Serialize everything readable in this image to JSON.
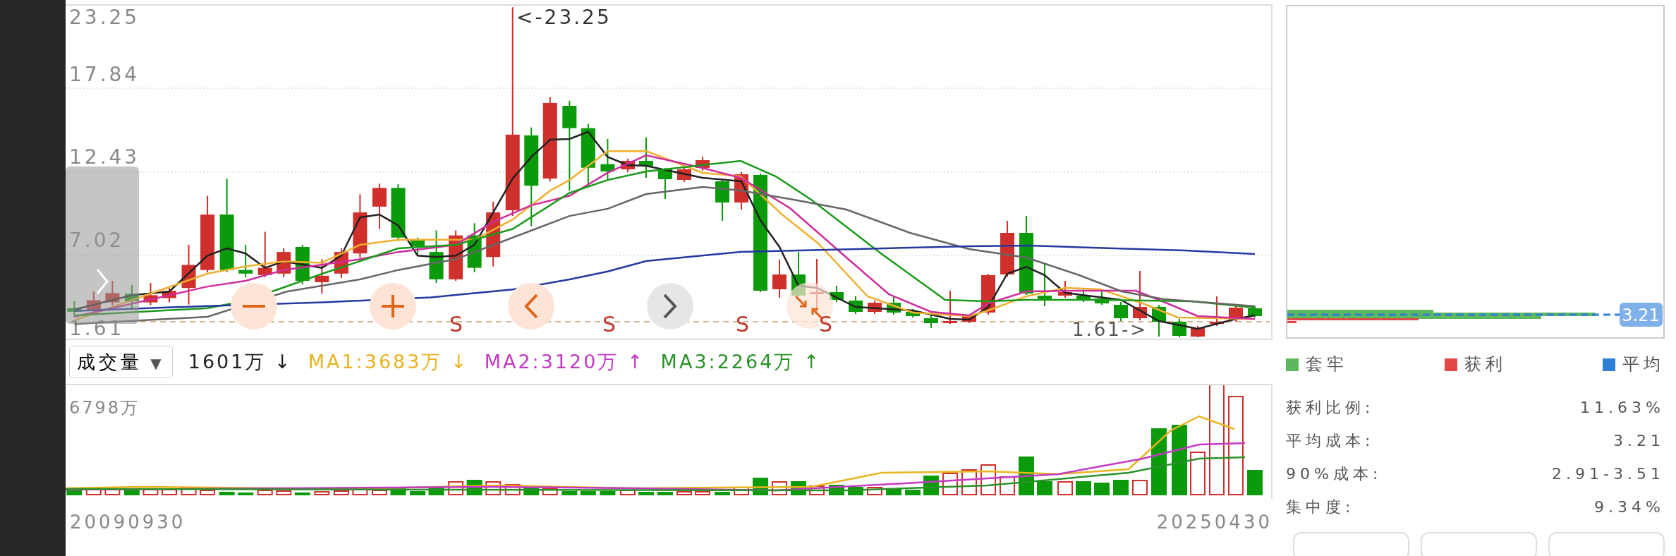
{
  "price_chart": {
    "axis_labels": [
      "23.25",
      "17.84",
      "12.43",
      "7.02",
      "1.61"
    ],
    "max_label": "<-23.25",
    "min_label": "1.61->",
    "signals": [
      "S",
      "S",
      "S",
      "S"
    ],
    "controls": [
      {
        "kind": "zoom_out"
      },
      {
        "kind": "zoom_in"
      },
      {
        "kind": "prev"
      },
      {
        "kind": "next"
      }
    ]
  },
  "volume_header": {
    "selector": "成交量",
    "caret": "▼",
    "indicators": [
      {
        "text": "1601万 ↓",
        "color": "#222222"
      },
      {
        "text": "MA1:3683万 ↓",
        "color": "#e8b420"
      },
      {
        "text": "MA2:3120万 ↑",
        "color": "#c43ac4"
      },
      {
        "text": "MA3:2264万 ↑",
        "color": "#2a922a"
      }
    ]
  },
  "volume_chart": {
    "max_label": "6798万"
  },
  "dates": {
    "start": "20090930",
    "end": "20250430"
  },
  "chip_panel": {
    "price_badge": "3.21",
    "legend": [
      {
        "label": "套牢",
        "color": "#5cb85c"
      },
      {
        "label": "获利",
        "color": "#e04848"
      },
      {
        "label": "平均",
        "color": "#2f7fd8"
      }
    ],
    "stats": [
      {
        "label": "获利比例:",
        "value": "11.63%"
      },
      {
        "label": "平均成本:",
        "value": "3.21"
      },
      {
        "label": "90%成本:",
        "value": "2.91-3.51"
      },
      {
        "label": "集中度:",
        "value": "9.34%"
      }
    ],
    "bottom_buttons": [
      {
        "kind": "outline"
      },
      {
        "kind": "outline"
      },
      {
        "kind": "outline"
      }
    ]
  }
}
